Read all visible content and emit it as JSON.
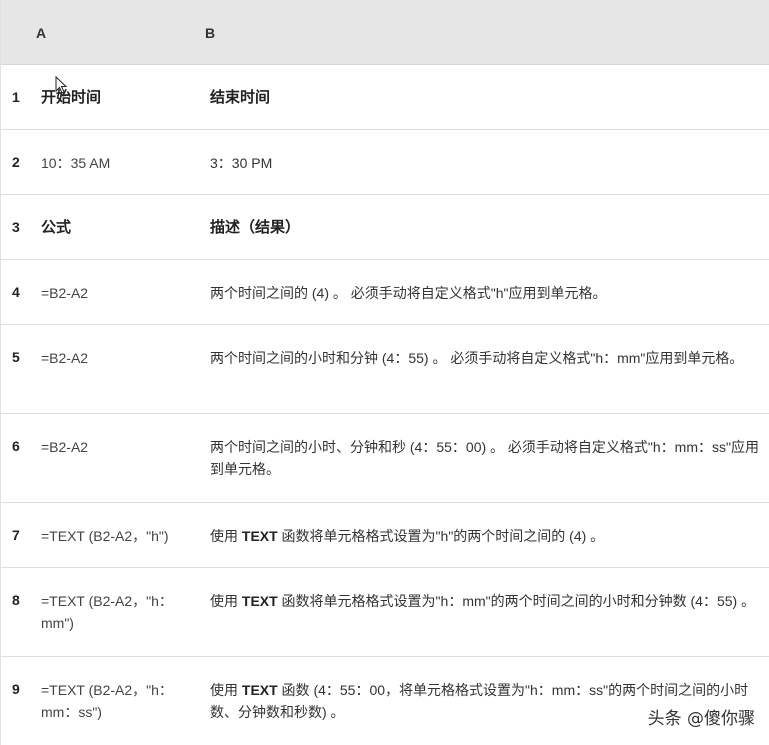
{
  "header": {
    "col_a": "A",
    "col_b": "B"
  },
  "rows": [
    {
      "num": "1",
      "a": "开始时间",
      "b_pre": "结束时间",
      "b_kw": "",
      "b_post": ""
    },
    {
      "num": "2",
      "a": "10：35 AM",
      "b_pre": "3：30 PM",
      "b_kw": "",
      "b_post": ""
    },
    {
      "num": "3",
      "a": "公式",
      "b_pre": "描述（结果）",
      "b_kw": "",
      "b_post": ""
    },
    {
      "num": "4",
      "a": "=B2-A2",
      "b_pre": "两个时间之间的 (4) 。 必须手动将自定义格式\"h\"应用到单元格。",
      "b_kw": "",
      "b_post": ""
    },
    {
      "num": "5",
      "a": "=B2-A2",
      "b_pre": "两个时间之间的小时和分钟 (4：55) 。 必须手动将自定义格式\"h：mm\"应用到单元格。",
      "b_kw": "",
      "b_post": ""
    },
    {
      "num": "6",
      "a": "=B2-A2",
      "b_pre": "两个时间之间的小时、分钟和秒 (4：55：00) 。 必须手动将自定义格式\"h：mm：ss\"应用到单元格。",
      "b_kw": "",
      "b_post": ""
    },
    {
      "num": "7",
      "a": "=TEXT (B2-A2，\"h\")",
      "b_pre": "使用 ",
      "b_kw": "TEXT",
      "b_post": " 函数将单元格格式设置为\"h\"的两个时间之间的 (4) 。"
    },
    {
      "num": "8",
      "a": "=TEXT (B2-A2，\"h：mm\")",
      "b_pre": "使用 ",
      "b_kw": "TEXT",
      "b_post": " 函数将单元格格式设置为\"h：mm\"的两个时间之间的小时和分钟数 (4：55) 。"
    },
    {
      "num": "9",
      "a": "=TEXT (B2-A2，\"h：mm：ss\")",
      "b_pre": "使用 ",
      "b_kw": "TEXT",
      "b_post": " 函数 (4：55：00，将单元格格式设置为\"h：mm：ss\"的两个时间之间的小时数、分钟数和秒数) 。"
    }
  ],
  "watermark": "头条 @傻你骤"
}
